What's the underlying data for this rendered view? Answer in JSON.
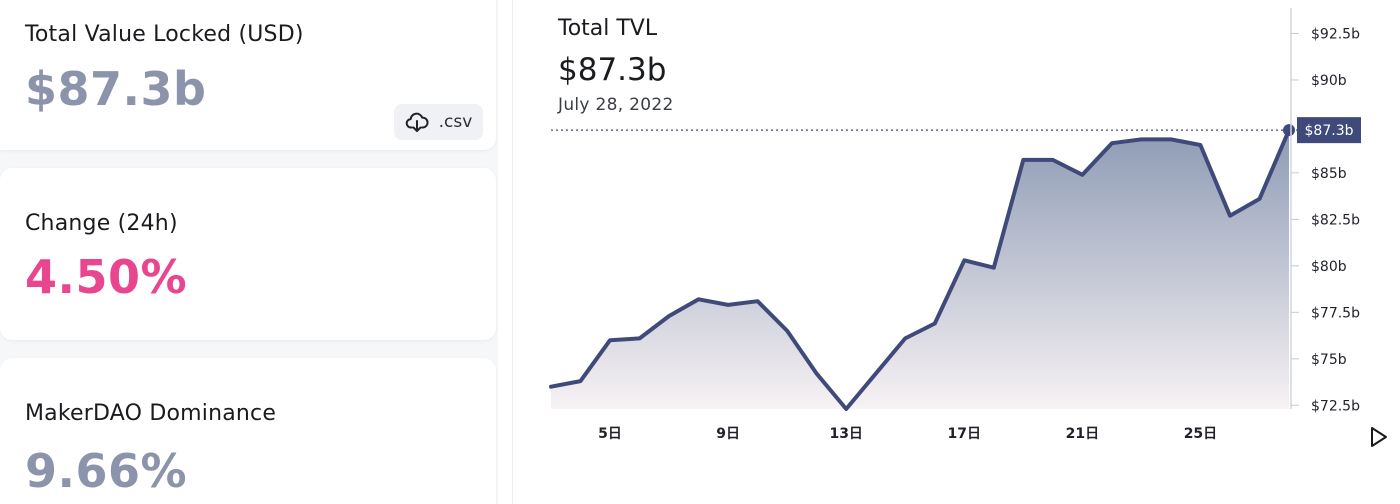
{
  "stats": {
    "tvl": {
      "label": "Total Value Locked (USD)",
      "value": "$87.3b",
      "download_label": ".csv",
      "download_icon": "cloud-download-icon"
    },
    "change": {
      "label": "Change (24h)",
      "value": "4.50%",
      "color": "#e8468e"
    },
    "dominance": {
      "label": "MakerDAO Dominance",
      "value": "9.66%"
    }
  },
  "chart": {
    "title": "Total TVL",
    "value": "$87.3b",
    "date": "July 28, 2022",
    "current_marker": "$87.3b",
    "play_icon": "play-icon",
    "colors": {
      "line": "#3f4a7a",
      "fill_top": "#8e9bb5",
      "fill_bottom": "#f7f2f4",
      "marker_bg": "#3f4a7a"
    }
  },
  "chart_data": {
    "type": "area",
    "x": [
      3,
      4,
      5,
      6,
      7,
      8,
      9,
      10,
      11,
      12,
      13,
      14,
      15,
      16,
      17,
      18,
      19,
      20,
      21,
      22,
      23,
      24,
      25,
      26,
      27,
      28
    ],
    "values": [
      73.5,
      73.8,
      76.0,
      76.1,
      77.3,
      78.2,
      77.9,
      78.1,
      76.5,
      74.2,
      72.3,
      74.2,
      76.1,
      76.9,
      80.3,
      79.9,
      85.7,
      85.7,
      84.9,
      86.6,
      86.8,
      86.8,
      86.5,
      82.7,
      83.6,
      87.3
    ],
    "xticks": [
      {
        "x": 5,
        "label": "5日"
      },
      {
        "x": 9,
        "label": "9日"
      },
      {
        "x": 13,
        "label": "13日"
      },
      {
        "x": 17,
        "label": "17日"
      },
      {
        "x": 21,
        "label": "21日"
      },
      {
        "x": 25,
        "label": "25日"
      }
    ],
    "yticks": [
      {
        "v": 72.5,
        "label": "$72.5b"
      },
      {
        "v": 75,
        "label": "$75b"
      },
      {
        "v": 77.5,
        "label": "$77.5b"
      },
      {
        "v": 80,
        "label": "$80b"
      },
      {
        "v": 82.5,
        "label": "$82.5b"
      },
      {
        "v": 85,
        "label": "$85b"
      },
      {
        "v": 90,
        "label": "$90b"
      },
      {
        "v": 92.5,
        "label": "$92.5b"
      }
    ],
    "ylim": [
      72.3,
      94.3
    ],
    "xlim": [
      3,
      28
    ]
  }
}
